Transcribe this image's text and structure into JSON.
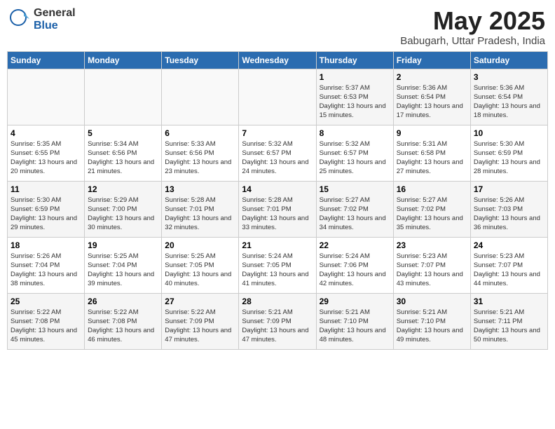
{
  "logo": {
    "general": "General",
    "blue": "Blue"
  },
  "title": "May 2025",
  "subtitle": "Babugarh, Uttar Pradesh, India",
  "days_of_week": [
    "Sunday",
    "Monday",
    "Tuesday",
    "Wednesday",
    "Thursday",
    "Friday",
    "Saturday"
  ],
  "weeks": [
    [
      {
        "day": "",
        "content": ""
      },
      {
        "day": "",
        "content": ""
      },
      {
        "day": "",
        "content": ""
      },
      {
        "day": "",
        "content": ""
      },
      {
        "day": "1",
        "content": "Sunrise: 5:37 AM\nSunset: 6:53 PM\nDaylight: 13 hours and 15 minutes."
      },
      {
        "day": "2",
        "content": "Sunrise: 5:36 AM\nSunset: 6:54 PM\nDaylight: 13 hours and 17 minutes."
      },
      {
        "day": "3",
        "content": "Sunrise: 5:36 AM\nSunset: 6:54 PM\nDaylight: 13 hours and 18 minutes."
      }
    ],
    [
      {
        "day": "4",
        "content": "Sunrise: 5:35 AM\nSunset: 6:55 PM\nDaylight: 13 hours and 20 minutes."
      },
      {
        "day": "5",
        "content": "Sunrise: 5:34 AM\nSunset: 6:56 PM\nDaylight: 13 hours and 21 minutes."
      },
      {
        "day": "6",
        "content": "Sunrise: 5:33 AM\nSunset: 6:56 PM\nDaylight: 13 hours and 23 minutes."
      },
      {
        "day": "7",
        "content": "Sunrise: 5:32 AM\nSunset: 6:57 PM\nDaylight: 13 hours and 24 minutes."
      },
      {
        "day": "8",
        "content": "Sunrise: 5:32 AM\nSunset: 6:57 PM\nDaylight: 13 hours and 25 minutes."
      },
      {
        "day": "9",
        "content": "Sunrise: 5:31 AM\nSunset: 6:58 PM\nDaylight: 13 hours and 27 minutes."
      },
      {
        "day": "10",
        "content": "Sunrise: 5:30 AM\nSunset: 6:59 PM\nDaylight: 13 hours and 28 minutes."
      }
    ],
    [
      {
        "day": "11",
        "content": "Sunrise: 5:30 AM\nSunset: 6:59 PM\nDaylight: 13 hours and 29 minutes."
      },
      {
        "day": "12",
        "content": "Sunrise: 5:29 AM\nSunset: 7:00 PM\nDaylight: 13 hours and 30 minutes."
      },
      {
        "day": "13",
        "content": "Sunrise: 5:28 AM\nSunset: 7:01 PM\nDaylight: 13 hours and 32 minutes."
      },
      {
        "day": "14",
        "content": "Sunrise: 5:28 AM\nSunset: 7:01 PM\nDaylight: 13 hours and 33 minutes."
      },
      {
        "day": "15",
        "content": "Sunrise: 5:27 AM\nSunset: 7:02 PM\nDaylight: 13 hours and 34 minutes."
      },
      {
        "day": "16",
        "content": "Sunrise: 5:27 AM\nSunset: 7:02 PM\nDaylight: 13 hours and 35 minutes."
      },
      {
        "day": "17",
        "content": "Sunrise: 5:26 AM\nSunset: 7:03 PM\nDaylight: 13 hours and 36 minutes."
      }
    ],
    [
      {
        "day": "18",
        "content": "Sunrise: 5:26 AM\nSunset: 7:04 PM\nDaylight: 13 hours and 38 minutes."
      },
      {
        "day": "19",
        "content": "Sunrise: 5:25 AM\nSunset: 7:04 PM\nDaylight: 13 hours and 39 minutes."
      },
      {
        "day": "20",
        "content": "Sunrise: 5:25 AM\nSunset: 7:05 PM\nDaylight: 13 hours and 40 minutes."
      },
      {
        "day": "21",
        "content": "Sunrise: 5:24 AM\nSunset: 7:05 PM\nDaylight: 13 hours and 41 minutes."
      },
      {
        "day": "22",
        "content": "Sunrise: 5:24 AM\nSunset: 7:06 PM\nDaylight: 13 hours and 42 minutes."
      },
      {
        "day": "23",
        "content": "Sunrise: 5:23 AM\nSunset: 7:07 PM\nDaylight: 13 hours and 43 minutes."
      },
      {
        "day": "24",
        "content": "Sunrise: 5:23 AM\nSunset: 7:07 PM\nDaylight: 13 hours and 44 minutes."
      }
    ],
    [
      {
        "day": "25",
        "content": "Sunrise: 5:22 AM\nSunset: 7:08 PM\nDaylight: 13 hours and 45 minutes."
      },
      {
        "day": "26",
        "content": "Sunrise: 5:22 AM\nSunset: 7:08 PM\nDaylight: 13 hours and 46 minutes."
      },
      {
        "day": "27",
        "content": "Sunrise: 5:22 AM\nSunset: 7:09 PM\nDaylight: 13 hours and 47 minutes."
      },
      {
        "day": "28",
        "content": "Sunrise: 5:21 AM\nSunset: 7:09 PM\nDaylight: 13 hours and 47 minutes."
      },
      {
        "day": "29",
        "content": "Sunrise: 5:21 AM\nSunset: 7:10 PM\nDaylight: 13 hours and 48 minutes."
      },
      {
        "day": "30",
        "content": "Sunrise: 5:21 AM\nSunset: 7:10 PM\nDaylight: 13 hours and 49 minutes."
      },
      {
        "day": "31",
        "content": "Sunrise: 5:21 AM\nSunset: 7:11 PM\nDaylight: 13 hours and 50 minutes."
      }
    ]
  ]
}
